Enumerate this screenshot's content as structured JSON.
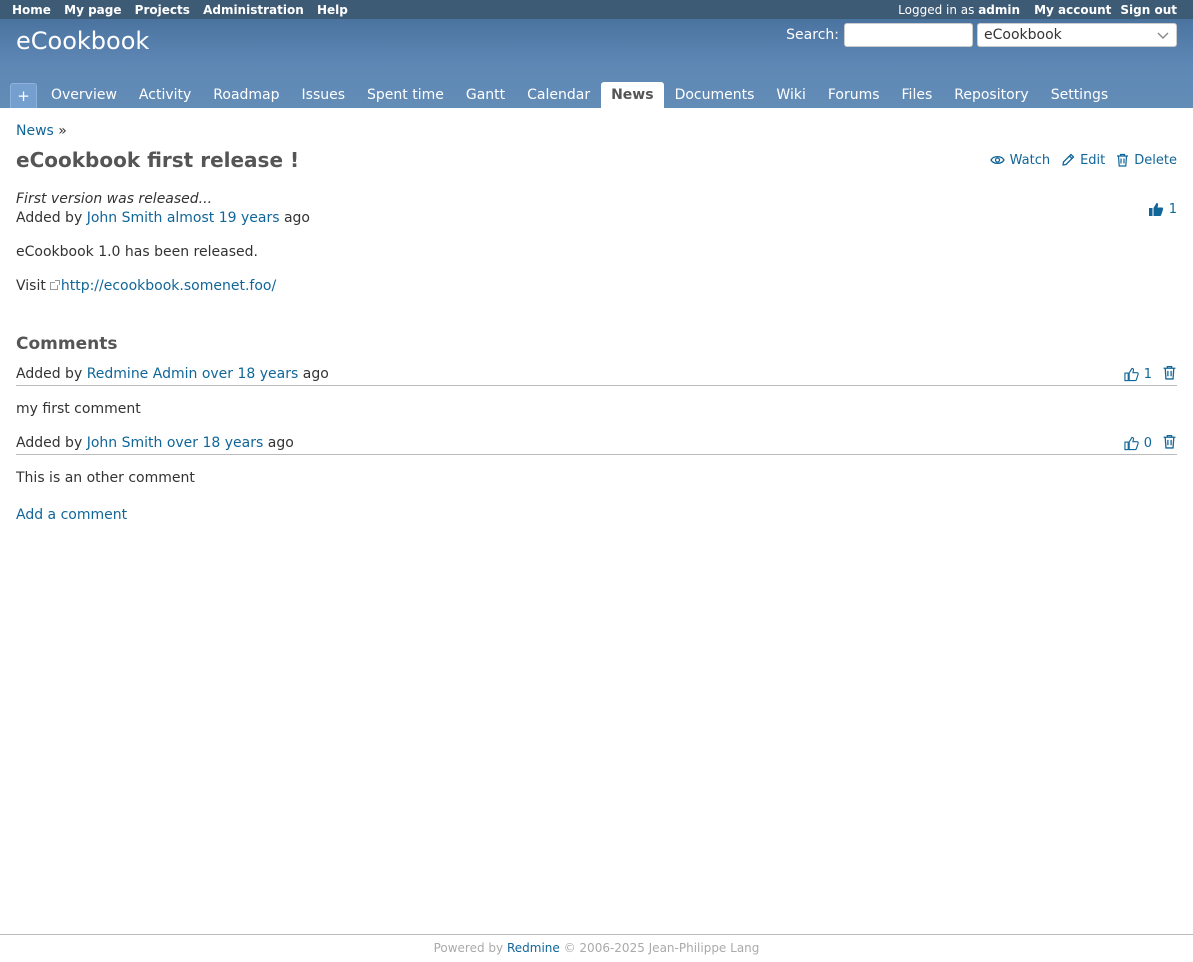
{
  "top_menu": {
    "left": [
      "Home",
      "My page",
      "Projects",
      "Administration",
      "Help"
    ],
    "logged_in_prefix": "Logged in as",
    "user": "admin",
    "my_account": "My account",
    "sign_out": "Sign out"
  },
  "header": {
    "project_title": "eCookbook",
    "search_label": "Search:",
    "search_value": "",
    "project_select": "eCookbook"
  },
  "main_menu": {
    "new_object": "+",
    "tabs": [
      "Overview",
      "Activity",
      "Roadmap",
      "Issues",
      "Spent time",
      "Gantt",
      "Calendar",
      "News",
      "Documents",
      "Wiki",
      "Forums",
      "Files",
      "Repository",
      "Settings"
    ],
    "selected": "News"
  },
  "breadcrumb": {
    "link": "News",
    "sep": "»"
  },
  "news": {
    "title": "eCookbook first release !",
    "actions": {
      "watch": "Watch",
      "edit": "Edit",
      "delete": "Delete"
    },
    "summary": "First version was released...",
    "added_by": "Added by",
    "author": "John Smith",
    "time": "almost 19 years",
    "ago": "ago",
    "reaction_count": "1",
    "body_line": "eCookbook 1.0 has been released.",
    "visit_label": "Visit",
    "visit_url": "http://ecookbook.somenet.foo/"
  },
  "comments": {
    "heading": "Comments",
    "items": [
      {
        "added_by": "Added by",
        "author": "Redmine Admin",
        "time": "over 18 years",
        "ago": "ago",
        "reactions": "1",
        "text": "my first comment"
      },
      {
        "added_by": "Added by",
        "author": "John Smith",
        "time": "over 18 years",
        "ago": "ago",
        "reactions": "0",
        "text": "This is an other comment"
      }
    ],
    "add_comment": "Add a comment"
  },
  "footer": {
    "powered_by": "Powered by",
    "redmine": "Redmine",
    "copyright": "© 2006-2025 Jean-Philippe Lang"
  },
  "colors": {
    "link": "#116699",
    "header_top": "#3e5b76",
    "header_bg": "#628db6"
  }
}
